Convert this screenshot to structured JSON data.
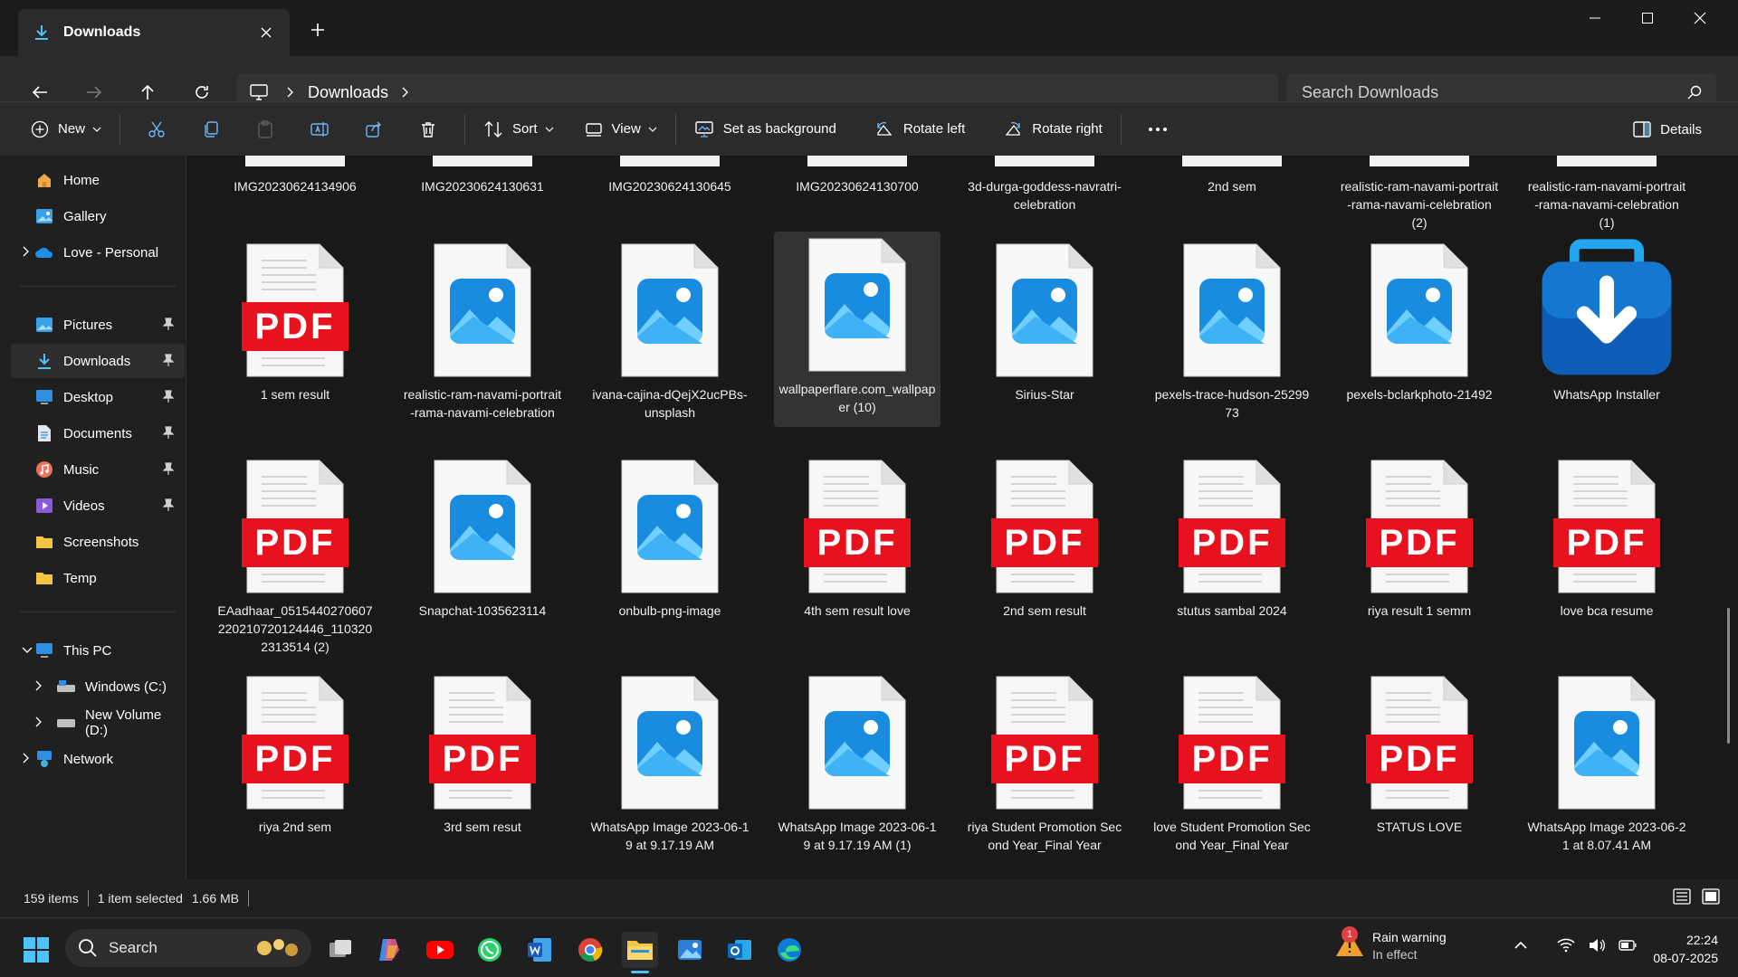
{
  "tab": {
    "title": "Downloads"
  },
  "address": {
    "location": "Downloads"
  },
  "search": {
    "placeholder": "Search Downloads"
  },
  "commands": {
    "new": "New",
    "sort": "Sort",
    "view": "View",
    "set_background": "Set as background",
    "rotate_left": "Rotate left",
    "rotate_right": "Rotate right",
    "details": "Details"
  },
  "sidebar": {
    "home": "Home",
    "gallery": "Gallery",
    "onedrive": "Love - Personal",
    "pictures": "Pictures",
    "downloads": "Downloads",
    "desktop": "Desktop",
    "documents": "Documents",
    "music": "Music",
    "videos": "Videos",
    "screenshots": "Screenshots",
    "temp": "Temp",
    "thispc": "This PC",
    "windows_c": "Windows (C:)",
    "new_volume_d": "New Volume (D:)",
    "network": "Network"
  },
  "files_top_row": [
    "IMG20230624134906",
    "IMG20230624130631",
    "IMG20230624130645",
    "IMG20230624130700",
    "3d-durga-goddess-navratri-celebration",
    "2nd sem",
    "realistic-ram-navami-portrait-rama-navami-celebration (2)",
    "realistic-ram-navami-portrait-rama-navami-celebration (1)"
  ],
  "files": [
    {
      "name": "1 sem result",
      "type": "pdf"
    },
    {
      "name": "realistic-ram-navami-portrait-rama-navami-celebration",
      "type": "image"
    },
    {
      "name": "ivana-cajina-dQejX2ucPBs-unsplash",
      "type": "image"
    },
    {
      "name": "wallpaperflare.com_wallpaper (10)",
      "type": "image",
      "selected": true
    },
    {
      "name": "Sirius-Star",
      "type": "image"
    },
    {
      "name": "pexels-trace-hudson-2529973",
      "type": "image"
    },
    {
      "name": "pexels-bclarkphoto-21492",
      "type": "image"
    },
    {
      "name": "WhatsApp Installer",
      "type": "installer"
    },
    {
      "name": "EAadhaar_0515440270607220210720124446_1103202313514 (2)",
      "type": "pdf"
    },
    {
      "name": "Snapchat-1035623114",
      "type": "image"
    },
    {
      "name": "onbulb-png-image",
      "type": "image"
    },
    {
      "name": "4th sem result love",
      "type": "pdf"
    },
    {
      "name": "2nd sem result",
      "type": "pdf"
    },
    {
      "name": "stutus sambal 2024",
      "type": "pdf"
    },
    {
      "name": "riya result 1 semm",
      "type": "pdf"
    },
    {
      "name": "love bca resume",
      "type": "pdf"
    },
    {
      "name": "riya 2nd sem",
      "type": "pdf"
    },
    {
      "name": "3rd sem resut",
      "type": "pdf"
    },
    {
      "name": "WhatsApp Image 2023-06-19 at 9.17.19 AM",
      "type": "image"
    },
    {
      "name": "WhatsApp Image 2023-06-19 at 9.17.19 AM (1)",
      "type": "image"
    },
    {
      "name": "riya Student Promotion Second Year_Final Year",
      "type": "pdf"
    },
    {
      "name": "love Student Promotion Second Year_Final Year",
      "type": "pdf"
    },
    {
      "name": "STATUS LOVE",
      "type": "pdf"
    },
    {
      "name": "WhatsApp Image 2023-06-21 at 8.07.41 AM",
      "type": "image"
    }
  ],
  "pdf_badge": "PDF",
  "status": {
    "count": "159 items",
    "selected": "1 item selected",
    "size": "1.66 MB"
  },
  "taskbar": {
    "search": "Search",
    "weather_title": "Rain warning",
    "weather_sub": "In effect",
    "weather_badge": "1",
    "time": "22:24",
    "date": "08-07-2025"
  },
  "colors": {
    "accent": "#4cc2ff",
    "pdf_red": "#e8111e",
    "folder_yellow": "#f5c542",
    "selection": "#333333"
  }
}
